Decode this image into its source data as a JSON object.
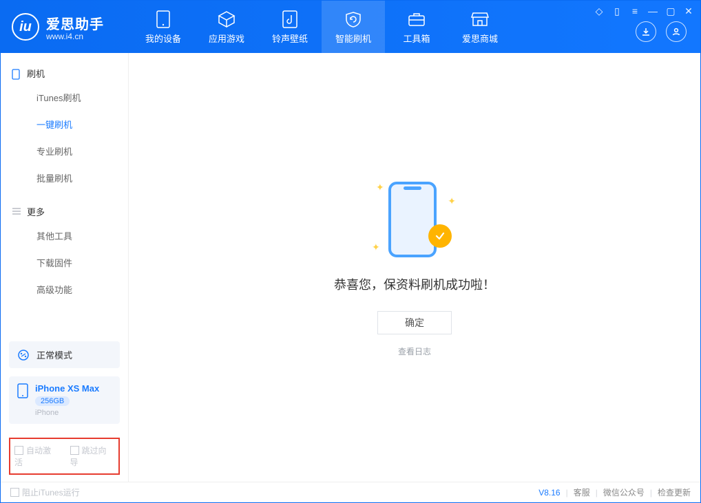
{
  "brand": {
    "name": "爱思助手",
    "url": "www.i4.cn"
  },
  "titlebar_icons": [
    "shirt-icon",
    "bookmark-icon",
    "menu-icon",
    "minimize-icon",
    "maximize-icon",
    "close-icon"
  ],
  "tabs": [
    {
      "key": "device",
      "label": "我的设备"
    },
    {
      "key": "apps",
      "label": "应用游戏"
    },
    {
      "key": "ring",
      "label": "铃声壁纸"
    },
    {
      "key": "flash",
      "label": "智能刷机",
      "active": true
    },
    {
      "key": "tools",
      "label": "工具箱"
    },
    {
      "key": "store",
      "label": "爱思商城"
    }
  ],
  "sidebar": {
    "groups": [
      {
        "title": "刷机",
        "icon": "phone",
        "items": [
          {
            "label": "iTunes刷机"
          },
          {
            "label": "一键刷机",
            "active": true
          },
          {
            "label": "专业刷机"
          },
          {
            "label": "批量刷机"
          }
        ]
      },
      {
        "title": "更多",
        "icon": "list",
        "items": [
          {
            "label": "其他工具"
          },
          {
            "label": "下载固件"
          },
          {
            "label": "高级功能"
          }
        ]
      }
    ],
    "mode_label": "正常模式",
    "device": {
      "name": "iPhone XS Max",
      "storage": "256GB",
      "type": "iPhone"
    },
    "redbox": {
      "opt1": "自动激活",
      "opt2": "跳过向导"
    }
  },
  "main": {
    "success_text": "恭喜您，保资料刷机成功啦！",
    "ok_button": "确定",
    "log_link": "查看日志"
  },
  "footer": {
    "block_itunes": "阻止iTunes运行",
    "version": "V8.16",
    "links": [
      "客服",
      "微信公众号",
      "检查更新"
    ]
  },
  "colors": {
    "primary": "#1a7bff",
    "accent": "#ffb400"
  }
}
